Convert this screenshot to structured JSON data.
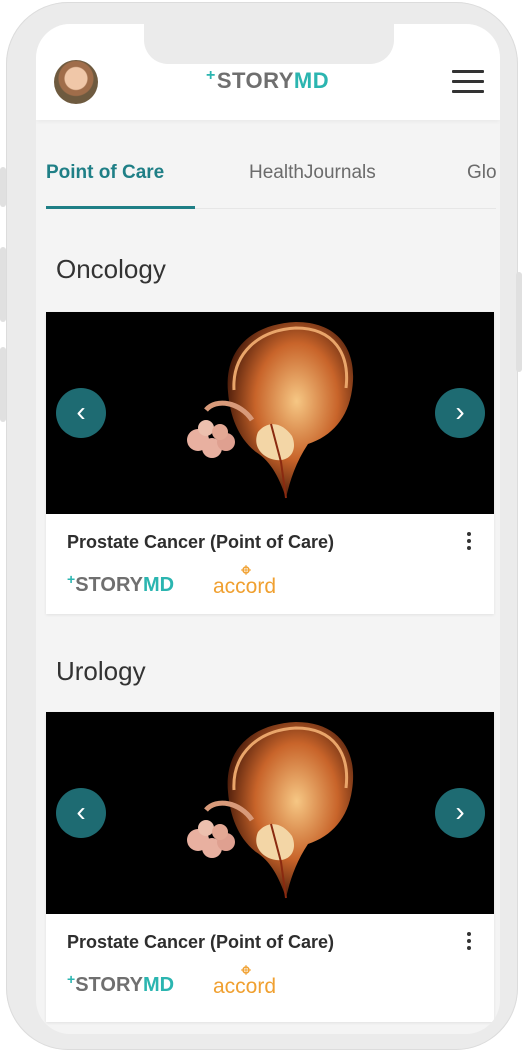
{
  "header": {
    "logo_plus": "+",
    "logo_story": "STORY",
    "logo_md": "MD"
  },
  "tabs": [
    {
      "label": "Point of Care",
      "active": true
    },
    {
      "label": "HealthJournals",
      "active": false
    },
    {
      "label": "Glo",
      "active": false
    }
  ],
  "sections": [
    {
      "title": "Oncology",
      "card": {
        "title": "Prostate Cancer (Point of Care)",
        "logo_plus": "+",
        "logo_story": "STORY",
        "logo_md": "MD",
        "partner": "accord"
      }
    },
    {
      "title": "Urology",
      "card": {
        "title": "Prostate Cancer (Point of Care)",
        "logo_plus": "+",
        "logo_story": "STORY",
        "logo_md": "MD",
        "partner": "accord"
      }
    }
  ],
  "icons": {
    "prev": "‹",
    "next": "›"
  },
  "colors": {
    "brand_teal": "#2bb5b0",
    "tab_active": "#1f7f86",
    "nav_button": "#1e6b72",
    "partner_orange": "#f0a030"
  }
}
